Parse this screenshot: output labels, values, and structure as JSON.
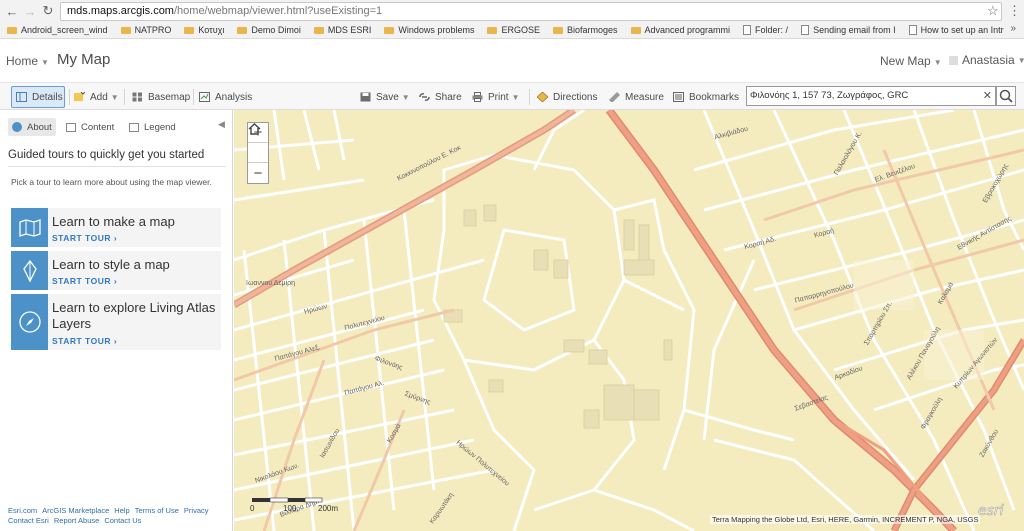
{
  "browser": {
    "url_host": "mds.maps.arcgis.com",
    "url_path": "/home/webmap/viewer.html?useExisting=1",
    "bookmarks": [
      {
        "label": "Android_screen_wind",
        "type": "folder"
      },
      {
        "label": "NATPRO",
        "type": "folder"
      },
      {
        "label": "Κοτυχι",
        "type": "folder"
      },
      {
        "label": "Demo Dimoi",
        "type": "folder"
      },
      {
        "label": "MDS ESRI",
        "type": "folder"
      },
      {
        "label": "Windows problems",
        "type": "folder"
      },
      {
        "label": "ERGOSE",
        "type": "folder"
      },
      {
        "label": "Biofarmoges",
        "type": "folder"
      },
      {
        "label": "Advanced programmi",
        "type": "folder"
      },
      {
        "label": "Folder: /",
        "type": "page"
      },
      {
        "label": "Sending email from I",
        "type": "page"
      },
      {
        "label": "How to set up an Intr",
        "type": "page"
      }
    ],
    "more": "»"
  },
  "header": {
    "home": "Home",
    "title": "My Map",
    "new_map": "New Map",
    "user": "Anastasia"
  },
  "toolbar": {
    "details": "Details",
    "add": "Add",
    "basemap": "Basemap",
    "analysis": "Analysis",
    "save": "Save",
    "share": "Share",
    "print": "Print",
    "directions": "Directions",
    "measure": "Measure",
    "bookmarks": "Bookmarks",
    "search_value": "Φιλονόης 1, 157 73, Ζωγράφος, GRC"
  },
  "sidebar": {
    "tabs": [
      "About",
      "Content",
      "Legend"
    ],
    "heading": "Guided tours to quickly get you started",
    "intro": "Pick a tour to learn more about using the map viewer.",
    "tours": [
      {
        "title": "Learn to make a map",
        "cta": "START TOUR"
      },
      {
        "title": "Learn to style a map",
        "cta": "START TOUR"
      },
      {
        "title": "Learn to explore Living Atlas Layers",
        "cta": "START TOUR"
      }
    ],
    "footer_row1": [
      "Esri.com",
      "ArcGIS Marketplace",
      "Help",
      "Terms of Use",
      "Privacy"
    ],
    "footer_row2": [
      "Contact Esri",
      "Report Abuse",
      "Contact Us"
    ]
  },
  "map": {
    "scale_labels": [
      "0",
      "100",
      "200m"
    ],
    "attribution": "Terra Mapping the Globe Ltd, Esri, HERE, Garmin, INCREMENT P, NGA, USGS",
    "logo": "esri",
    "street_labels": [
      "Κοκκινοπούλου Ε. Κοκ",
      "Αλκιβιάδου",
      "Ηρώων",
      "Πολυτεχνείου",
      "Ιωαννου Δεμίρη",
      "Παπάγου Αλεξ.",
      "Φιλονόης",
      "Σμύρνης",
      "Παπάγου Αλ.",
      "Κοραή Αδ.",
      "Ιασωνίδου",
      "Κοσμά",
      "Ηρώων Πολυτεχνείου",
      "Νικολάου Κων.",
      "Βιλλάρα Δημ.",
      "Καρυωτάκη",
      "Κοραή",
      "Ελ. Βενιζέλου",
      "Παλαιολόγου Κ.",
      "Εθνικής Αντίστασης",
      "Παπαρρηγοπούλου",
      "Σπαρτηρίου Σπ.",
      "Καλαμά",
      "Αλέκου Παναγούλη",
      "Κυπρίων Αγωνιστών",
      "Αρκαδίου",
      "Σεβαστείας",
      "Εβροκοχώρης",
      "Φραγκούλη",
      "Ζακύνθου"
    ]
  }
}
